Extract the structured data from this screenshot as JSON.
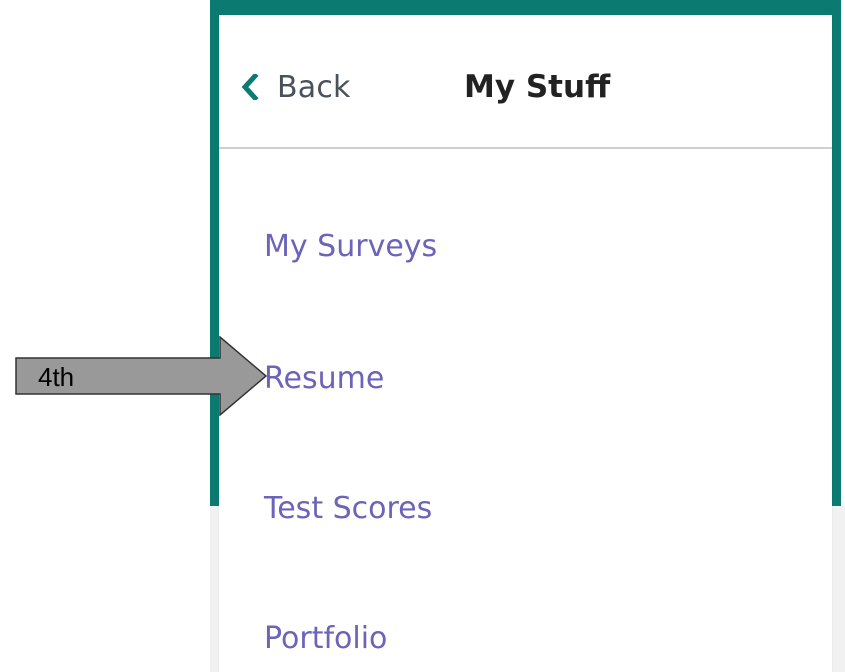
{
  "header": {
    "back_label": "Back",
    "title": "My Stuff",
    "back_icon": "chevron-left-icon"
  },
  "menu": {
    "items": [
      {
        "label": "My Surveys"
      },
      {
        "label": "Resume"
      },
      {
        "label": "Test Scores"
      },
      {
        "label": "Portfolio"
      }
    ]
  },
  "annotation": {
    "label": "4th",
    "fill_color": "#999999"
  },
  "colors": {
    "frame": "#0b7b72",
    "link": "#6b64b8",
    "title": "#222222",
    "back_text": "#49525a"
  }
}
